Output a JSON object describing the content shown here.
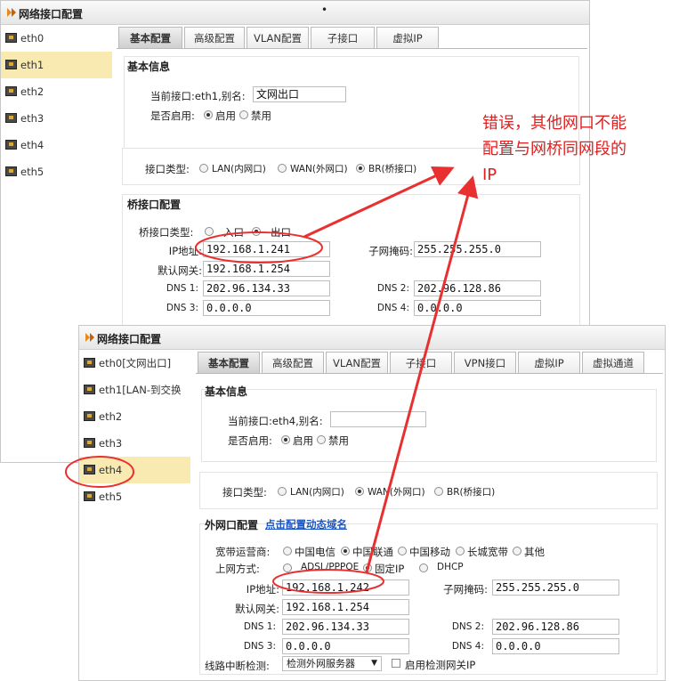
{
  "window1": {
    "title": "网络接口配置",
    "sidebar": [
      "eth0",
      "eth1",
      "eth2",
      "eth3",
      "eth4",
      "eth5"
    ],
    "active_item": "eth1",
    "tabs": [
      "基本配置",
      "高级配置",
      "VLAN配置",
      "子接口",
      "虚拟IP"
    ],
    "basic": {
      "title": "基本信息",
      "iface_label": "当前接口:eth1,别名:",
      "alias": "文网出口",
      "enable_label": "是否启用:",
      "enable_opt": "启用",
      "disable_opt": "禁用"
    },
    "type": {
      "label": "接口类型:",
      "lan": "LAN(内网口)",
      "wan": "WAN(外网口)",
      "br": "BR(桥接口)"
    },
    "bridge": {
      "title": "桥接口配置",
      "type_label": "桥接口类型:",
      "in_opt": "入口",
      "out_opt": "出口",
      "ip_label": "IP地址:",
      "ip": "192.168.1.241",
      "mask_label": "子网掩码:",
      "mask": "255.255.255.0",
      "gw_label": "默认网关:",
      "gw": "192.168.1.254",
      "dns1_label": "DNS 1:",
      "dns1": "202.96.134.33",
      "dns2_label": "DNS 2:",
      "dns2": "202.96.128.86",
      "dns3_label": "DNS 3:",
      "dns3": "0.0.0.0",
      "dns4_label": "DNS 4:",
      "dns4": "0.0.0.0"
    }
  },
  "window2": {
    "title": "网络接口配置",
    "sidebar": [
      "eth0[文网出口]",
      "eth1[LAN-到交换",
      "eth2",
      "eth3",
      "eth4",
      "eth5"
    ],
    "active_item": "eth4",
    "tabs": [
      "基本配置",
      "高级配置",
      "VLAN配置",
      "子接口",
      "VPN接口",
      "虚拟IP",
      "虚拟通道"
    ],
    "basic": {
      "title": "基本信息",
      "iface_label": "当前接口:eth4,别名:",
      "alias": "",
      "enable_label": "是否启用:",
      "enable_opt": "启用",
      "disable_opt": "禁用"
    },
    "type": {
      "label": "接口类型:",
      "lan": "LAN(内网口)",
      "wan": "WAN(外网口)",
      "br": "BR(桥接口)"
    },
    "wan": {
      "title": "外网口配置",
      "link": "点击配置动态域名",
      "isp_label": "宽带运营商:",
      "isps": [
        "中国电信",
        "中国联通",
        "中国移动",
        "长城宽带",
        "其他"
      ],
      "mode_label": "上网方式:",
      "modes": [
        "ADSL/PPPOE",
        "固定IP",
        "DHCP"
      ],
      "ip_label": "IP地址:",
      "ip": "192.168.1.242",
      "mask_label": "子网掩码:",
      "mask": "255.255.255.0",
      "gw_label": "默认网关:",
      "gw": "192.168.1.254",
      "dns1_label": "DNS 1:",
      "dns1": "202.96.134.33",
      "dns2_label": "DNS 2:",
      "dns2": "202.96.128.86",
      "dns3_label": "DNS 3:",
      "dns3": "0.0.0.0",
      "dns4_label": "DNS 4:",
      "dns4": "0.0.0.0",
      "detect_label": "线路中断检测:",
      "detect_value": "检测外网服务器",
      "gw_check_label": "启用检测网关IP"
    }
  },
  "annotation": {
    "line1": "错误，其他网口不能",
    "line2": "配置与网桥同网段的",
    "line3": "IP"
  },
  "colors": {
    "accent": "#e02020",
    "active_item": "#f8eab1",
    "link": "#1a55c9"
  }
}
